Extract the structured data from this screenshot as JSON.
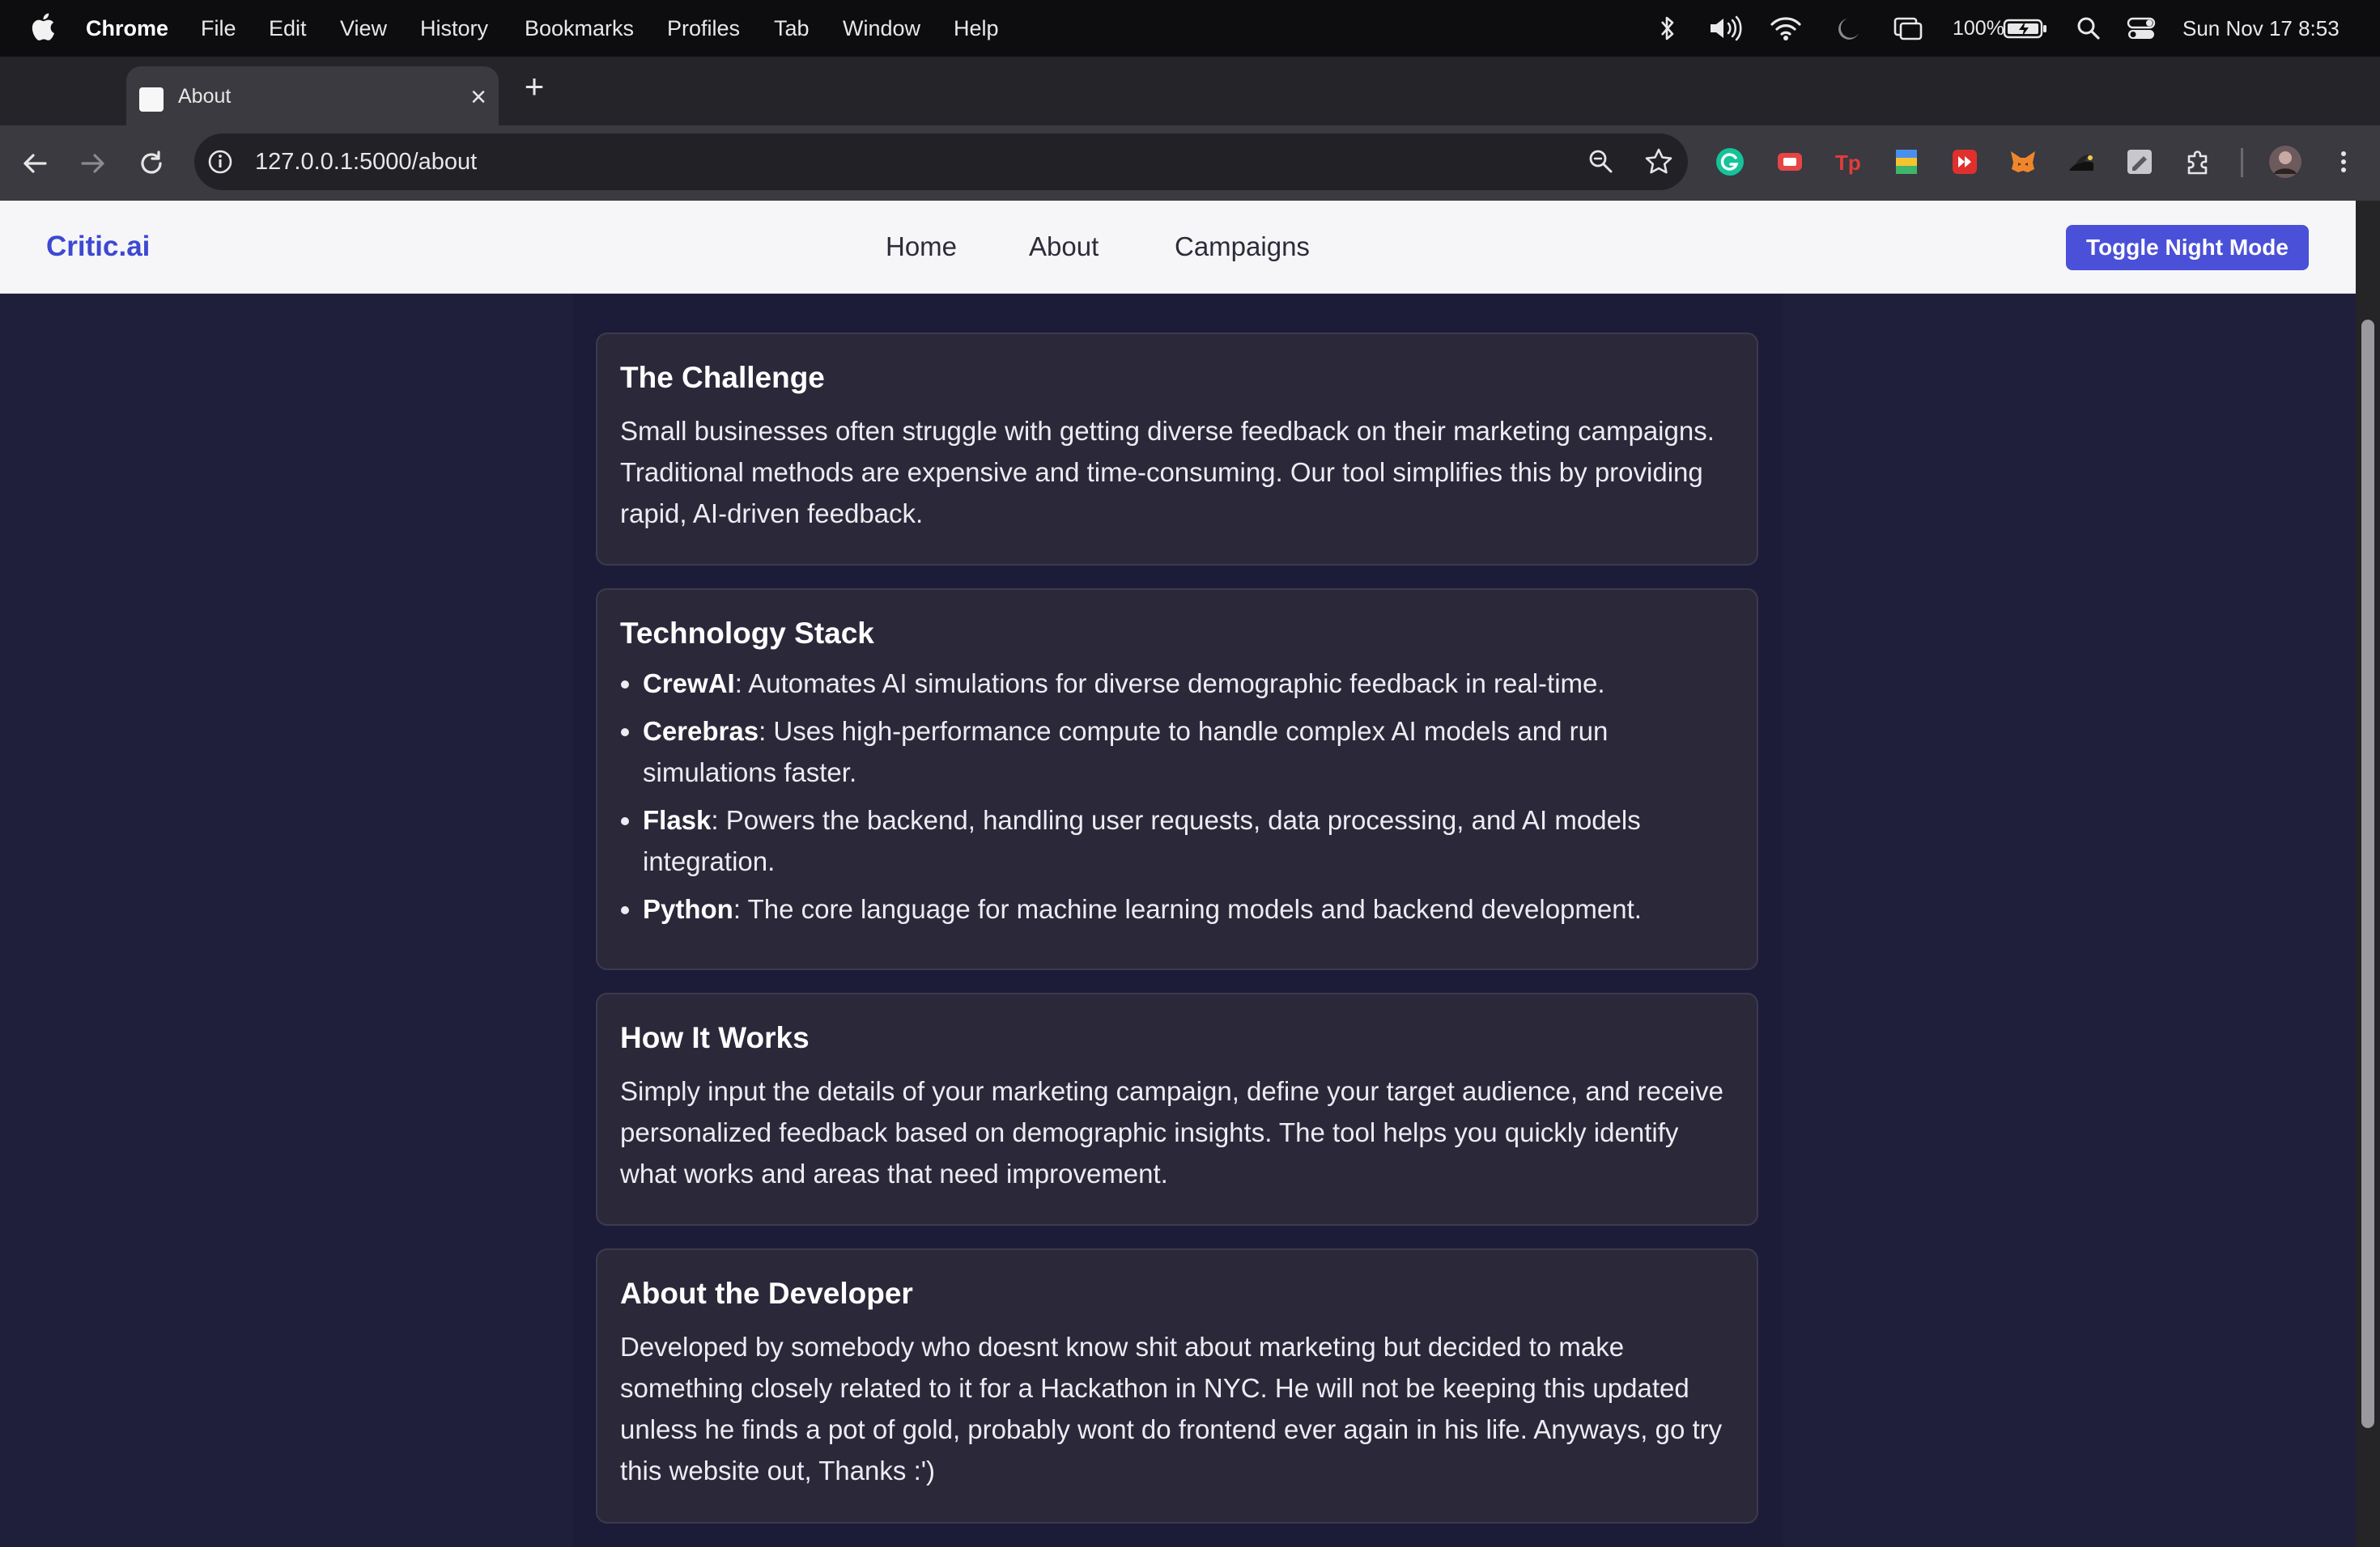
{
  "menubar": {
    "app": "Chrome",
    "items": [
      "File",
      "Edit",
      "View",
      "History",
      "Bookmarks",
      "Profiles",
      "Tab",
      "Window",
      "Help"
    ],
    "battery": "100%",
    "clock": "Sun Nov 17  8:53"
  },
  "browser": {
    "tab_title": "About",
    "url": "127.0.0.1:5000/about"
  },
  "site": {
    "brand": "Critic.ai",
    "nav": [
      "Home",
      "About",
      "Campaigns"
    ],
    "toggle_label": "Toggle Night Mode"
  },
  "sections": {
    "challenge": {
      "title": "The Challenge",
      "body": "Small businesses often struggle with getting diverse feedback on their marketing campaigns. Traditional methods are expensive and time-consuming. Our tool simplifies this by providing rapid, AI-driven feedback."
    },
    "stack": {
      "title": "Technology Stack",
      "items": [
        {
          "name": "CrewAI",
          "desc": ": Automates AI simulations for diverse demographic feedback in real-time."
        },
        {
          "name": "Cerebras",
          "desc": ": Uses high-performance compute to handle complex AI models and run simulations faster."
        },
        {
          "name": "Flask",
          "desc": ": Powers the backend, handling user requests, data processing, and AI models integration."
        },
        {
          "name": "Python",
          "desc": ": The core language for machine learning models and backend development."
        }
      ]
    },
    "how": {
      "title": "How It Works",
      "body": "Simply input the details of your marketing campaign, define your target audience, and receive personalized feedback based on demographic insights. The tool helps you quickly identify what works and areas that need improvement."
    },
    "developer": {
      "title": "About the Developer",
      "body": "Developed by somebody who doesnt know shit about marketing but decided to make something closely related to it for a Hackathon in NYC. He will not be keeping this updated unless he finds a pot of gold, probably wont do frontend ever again in his life. Anyways, go try this website out, Thanks :')"
    }
  }
}
